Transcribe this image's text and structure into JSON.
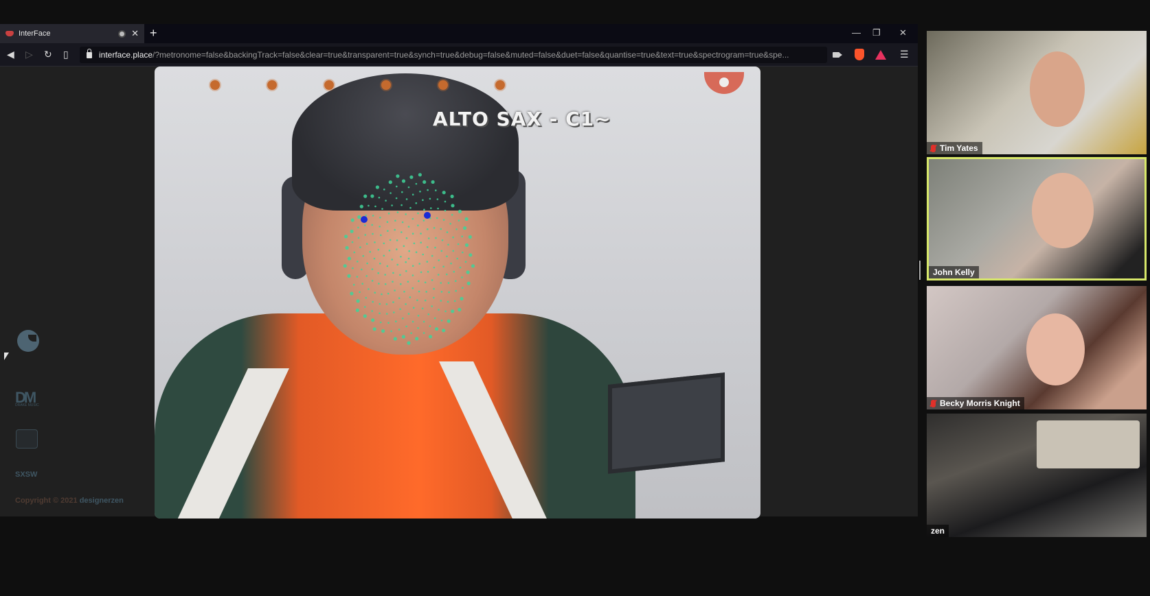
{
  "browser": {
    "tab_title": "InterFace",
    "url_host": "interface.place",
    "url_path": "/?metronome=false&backingTrack=false&clear=true&transparent=true&synch=true&debug=false&muted=false&duet=false&quantise=true&text=true&spectrogram=true&spe..."
  },
  "app": {
    "instrument_label": "ALTO SAX -  C1~",
    "sidebar_logos": [
      "designerzen-icon",
      "drake-music-logo",
      "badge-logo",
      "sxsw-logo"
    ],
    "dm_logo_text": "DM",
    "dm_logo_sub": "DRAKE MUSIC",
    "sxsw_text": "SXSW",
    "copyright_text": "Copyright © 2021",
    "copyright_brand": "designerzen",
    "metronome_dot_color": "#c56a2e"
  },
  "participants": [
    {
      "name": "Tim Yates",
      "muted": true
    },
    {
      "name": "John Kelly",
      "muted": false,
      "active_speaker": true
    },
    {
      "name": "Becky Morris Knight",
      "muted": true
    },
    {
      "name": "zen",
      "muted": false
    }
  ],
  "colors": {
    "active_speaker_border": "#d8e86a",
    "muted_mic": "#e0302a",
    "brand_accent": "#d76a59"
  }
}
